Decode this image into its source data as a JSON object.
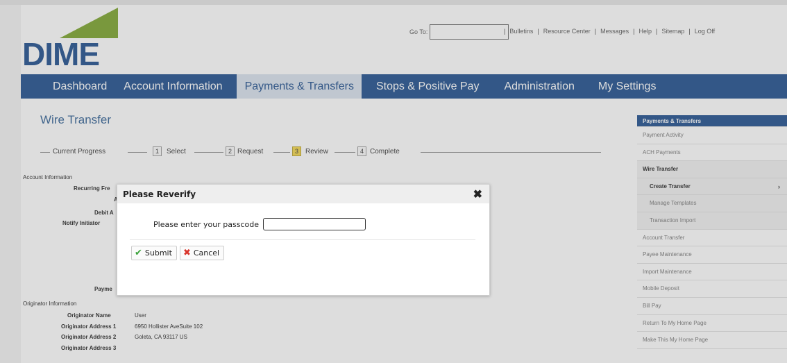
{
  "logo_text": "DIME",
  "header": {
    "goto_label": "Go To:",
    "links": [
      "Bulletins",
      "Resource Center",
      "Messages",
      "Help",
      "Sitemap",
      "Log Off"
    ]
  },
  "nav": {
    "items": [
      "Dashboard",
      "Account Information",
      "Payments & Transfers",
      "Stops & Positive Pay",
      "Administration",
      "My Settings"
    ],
    "active": "Payments & Transfers"
  },
  "page": {
    "title": "Wire Transfer",
    "progress": {
      "label": "Current Progress",
      "steps": [
        {
          "num": "1",
          "label": "Select"
        },
        {
          "num": "2",
          "label": "Request"
        },
        {
          "num": "3",
          "label": "Review"
        },
        {
          "num": "4",
          "label": "Complete"
        }
      ],
      "current": "3"
    },
    "account_info": {
      "heading": "Account Information",
      "recurring_partial": "Recurring Fre",
      "a_partial": "A",
      "debit_partial": "Debit A",
      "notify_partial": "Notify Initiator"
    },
    "payment_partial": "Payme",
    "originator": {
      "heading": "Originator Information",
      "rows": [
        {
          "label": "Originator Name",
          "value": "User"
        },
        {
          "label": "Originator Address 1",
          "value": "6950 Hollister AveSuite 102"
        },
        {
          "label": "Originator Address 2",
          "value": "Goleta, CA 93117 US"
        },
        {
          "label": "Originator Address 3",
          "value": ""
        }
      ]
    }
  },
  "sidebar": {
    "heading": "Payments & Transfers",
    "items": [
      {
        "label": "Payment Activity"
      },
      {
        "label": "ACH Payments"
      },
      {
        "label": "Wire Transfer"
      },
      {
        "label": "Create Transfer"
      },
      {
        "label": "Manage Templates"
      },
      {
        "label": "Transaction Import"
      },
      {
        "label": "Account Transfer"
      },
      {
        "label": "Payee Maintenance"
      },
      {
        "label": "Import Maintenance"
      },
      {
        "label": "Mobile Deposit"
      },
      {
        "label": "Bill Pay"
      },
      {
        "label": "Return To My Home Page"
      },
      {
        "label": "Make This My Home Page"
      }
    ]
  },
  "modal": {
    "title": "Please Reverify",
    "passcode_label": "Please enter your passcode",
    "passcode_value": "",
    "submit_label": "Submit",
    "cancel_label": "Cancel"
  },
  "colors": {
    "brand_blue": "#1c4d8c",
    "logo_green": "#7aa32a",
    "step_current": "#f2d547",
    "submit_icon": "#3aa23a",
    "cancel_icon": "#d9342b"
  }
}
